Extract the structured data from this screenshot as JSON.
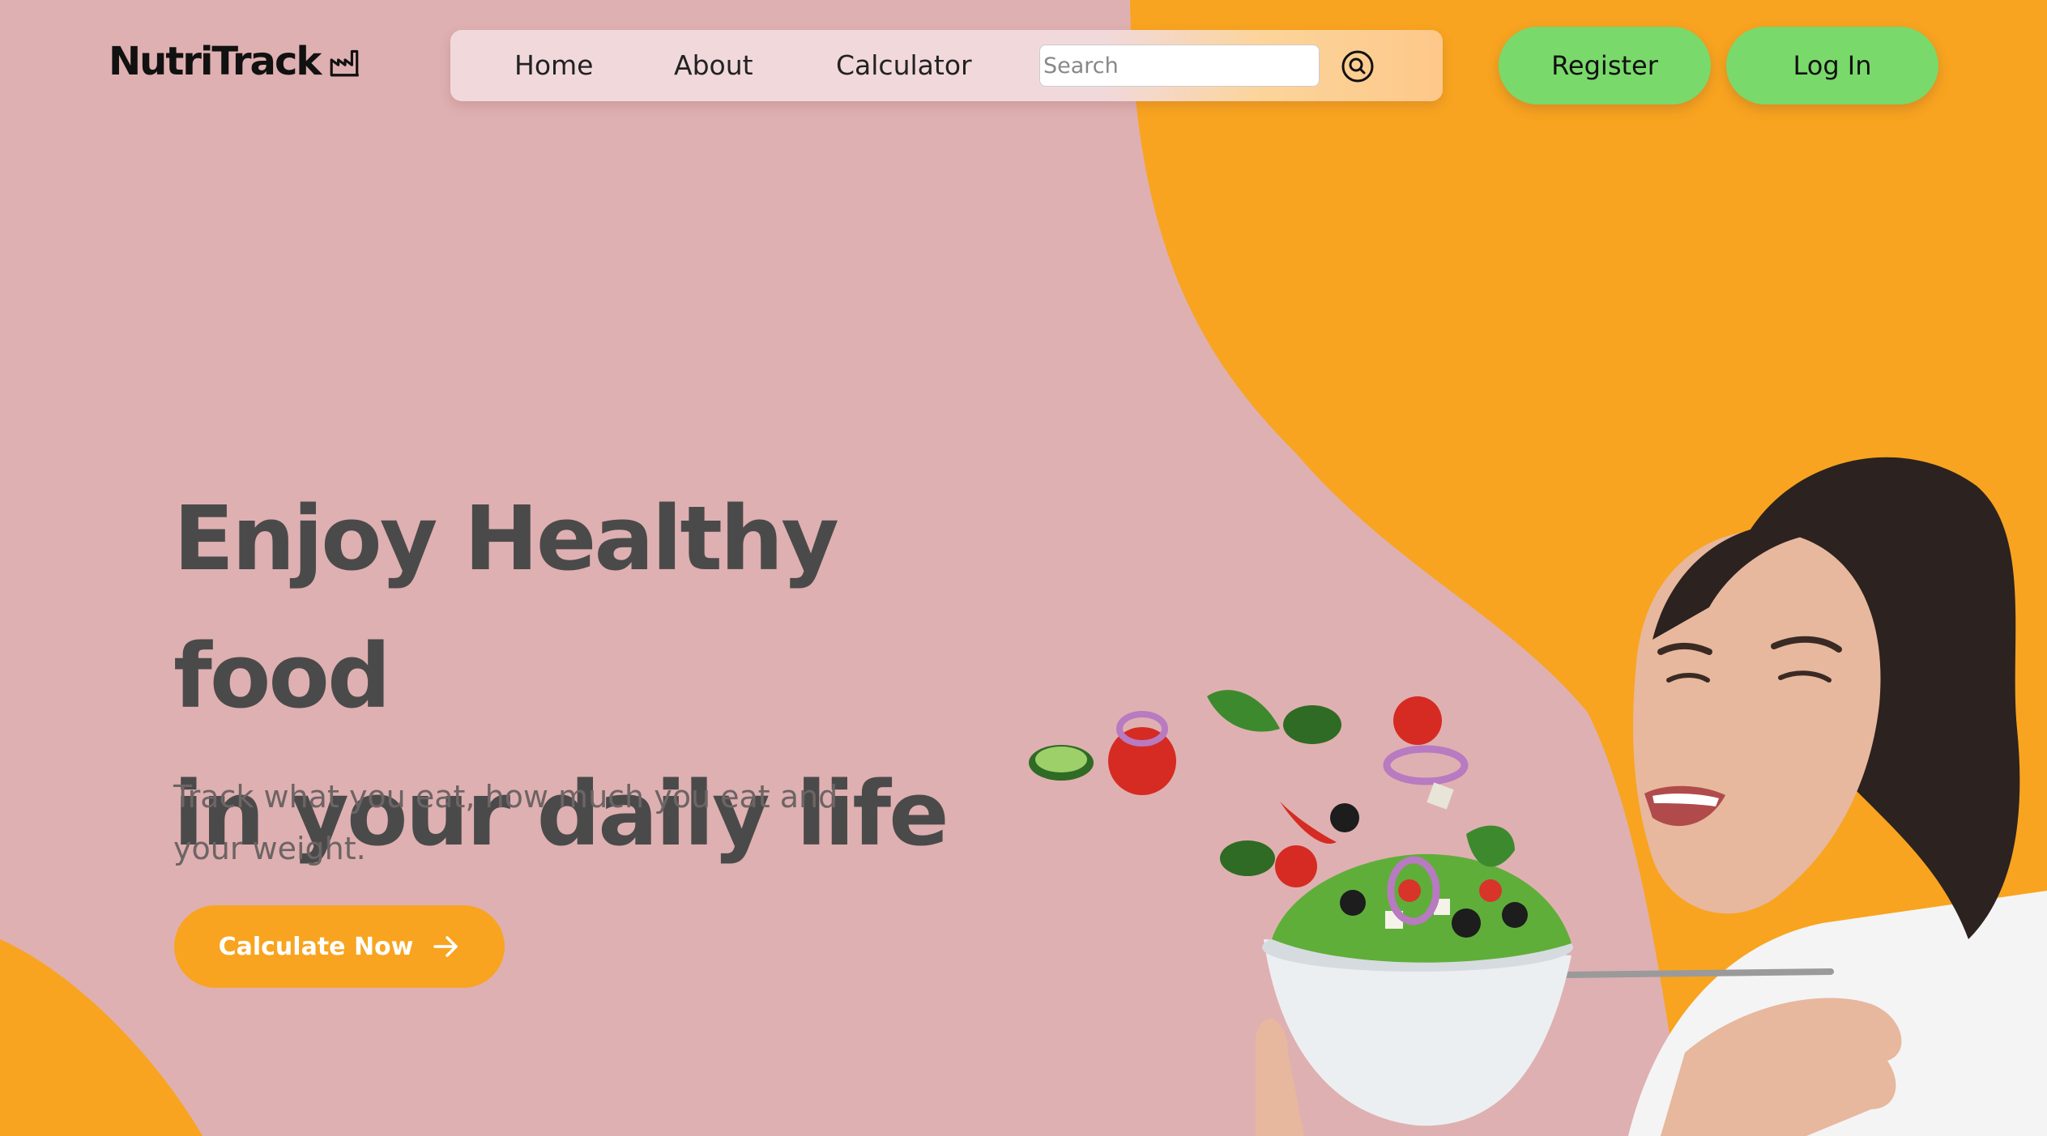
{
  "brand": {
    "name": "NutriTrack"
  },
  "nav": {
    "items": [
      {
        "label": "Home"
      },
      {
        "label": "About"
      },
      {
        "label": "Calculator"
      }
    ],
    "search": {
      "placeholder": "Search",
      "value": ""
    }
  },
  "auth": {
    "register_label": "Register",
    "login_label": "Log In"
  },
  "hero": {
    "title_line1": "Enjoy Healthy food",
    "title_line2": "in your daily life",
    "subtitle": "Track what you eat, how much you eat and your weight.",
    "cta_label": "Calculate Now"
  },
  "colors": {
    "background_pink": "#dfb0b1",
    "accent_orange": "#f8a420",
    "button_green": "#7ad96b",
    "heading_text": "#4b4a4a"
  },
  "icons": {
    "logo": "factory-icon",
    "search": "search-icon",
    "cta": "arrow-right-icon"
  }
}
